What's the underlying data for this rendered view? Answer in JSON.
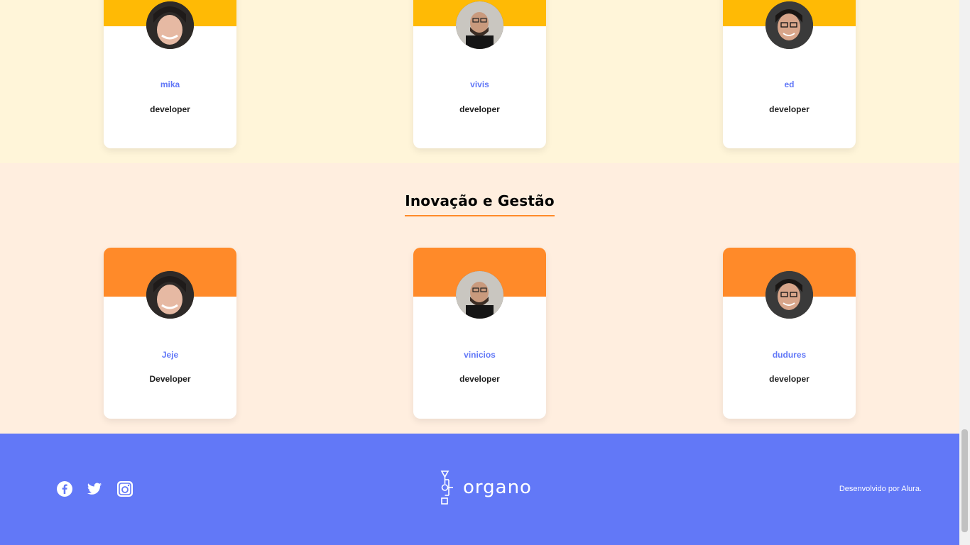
{
  "colors": {
    "accent": "#6278F7",
    "top_section_bg": "#FFF5D9",
    "top_card_head": "#FFBA05",
    "inov_section_bg": "#FFEEDF",
    "inov_card_head": "#FF8A29",
    "footer_bg": "#6278F7"
  },
  "top_team": {
    "members": [
      {
        "name": "mika",
        "role": "developer"
      },
      {
        "name": "vivis",
        "role": "developer"
      },
      {
        "name": "ed",
        "role": "developer"
      }
    ]
  },
  "inov_team": {
    "title": "Inovação e Gestão",
    "members": [
      {
        "name": "Jeje",
        "role": "Developer"
      },
      {
        "name": "vinicios",
        "role": "developer"
      },
      {
        "name": "dudures",
        "role": "developer"
      }
    ]
  },
  "footer": {
    "social_icons": [
      "facebook-icon",
      "twitter-icon",
      "instagram-icon"
    ],
    "logo_text": "organo",
    "credit": "Desenvolvido por Alura."
  }
}
